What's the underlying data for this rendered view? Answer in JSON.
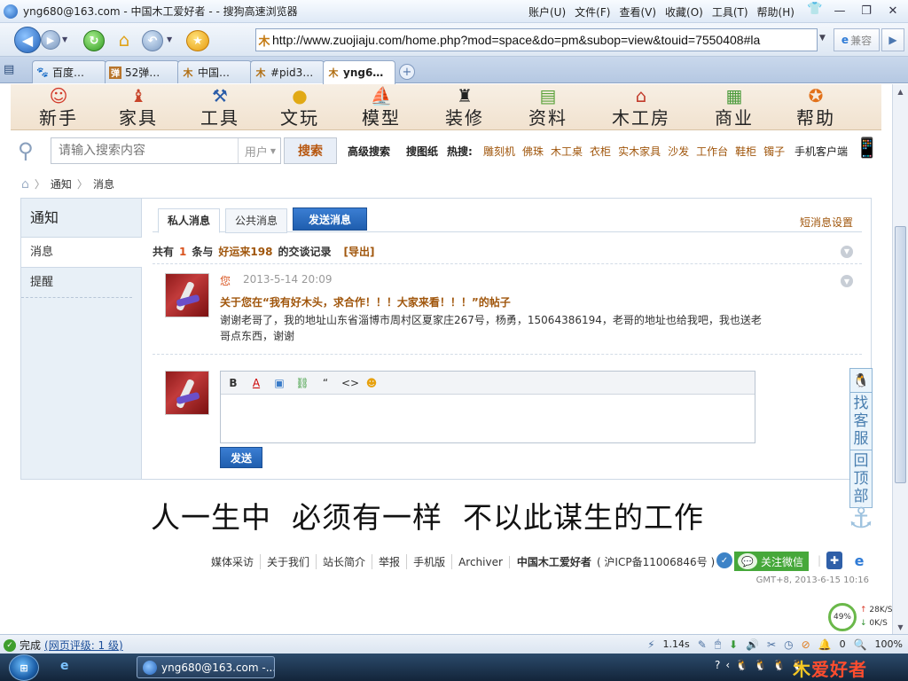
{
  "browser": {
    "window_title": "yng680@163.com - 中国木工爱好者 - - 搜狗高速浏览器",
    "menus": [
      "账户(U)",
      "文件(F)",
      "查看(V)",
      "收藏(O)",
      "工具(T)",
      "帮助(H)"
    ],
    "url": "http://www.zuojiaju.com/home.php?mod=space&do=pm&subop=view&touid=7550408#la",
    "compat_label": "兼容",
    "tabs": [
      {
        "label": "百度…"
      },
      {
        "label": "52弹…"
      },
      {
        "label": "中国…"
      },
      {
        "label": "#pid3…"
      },
      {
        "label": "yng6…"
      }
    ]
  },
  "site_nav": [
    {
      "label": "新手"
    },
    {
      "label": "家具"
    },
    {
      "label": "工具"
    },
    {
      "label": "文玩"
    },
    {
      "label": "模型"
    },
    {
      "label": "装修"
    },
    {
      "label": "资料"
    },
    {
      "label": "木工房"
    },
    {
      "label": "商业"
    },
    {
      "label": "帮助"
    }
  ],
  "search": {
    "placeholder": "请输入搜索内容",
    "type": "用户",
    "button": "搜索",
    "advanced": "高级搜索",
    "drawings": "搜图纸",
    "hot_label": "热搜:",
    "hot": [
      "雕刻机",
      "佛珠",
      "木工桌",
      "衣柜",
      "实木家具",
      "沙发",
      "工作台",
      "鞋柜",
      "镯子"
    ],
    "client": "手机客户端"
  },
  "breadcrumb": {
    "items": [
      "通知",
      "消息"
    ]
  },
  "sidebar": {
    "title": "通知",
    "items": [
      {
        "label": "消息"
      },
      {
        "label": "提醒"
      }
    ]
  },
  "tabs": {
    "private": "私人消息",
    "public": "公共消息",
    "send": "发送消息",
    "settings": "短消息设置"
  },
  "summary": {
    "prefix": "共有",
    "count": "1",
    "middle": "条与",
    "user": "好运来198",
    "suffix": "的交谈记录",
    "export": "[导出]"
  },
  "message": {
    "author": "您",
    "time": "2013-5-14 20:09",
    "subject": "关于您在“我有好木头，求合作！！！大家来看！！！”的帖子",
    "body": "谢谢老哥了，我的地址山东省淄博市周村区夏家庄267号，杨勇，15064386194，老哥的地址也给我吧，我也送老哥点东西，谢谢"
  },
  "reply": {
    "send": "发送"
  },
  "slogan": "人一生中  必须有一样  不以此谋生的工作",
  "side_float": {
    "service": "找客服",
    "top": "回顶部"
  },
  "footer": {
    "links": [
      "媒体采访",
      "关于我们",
      "站长简介",
      "举报",
      "手机版",
      "Archiver"
    ],
    "brand": "中国木工爱好者",
    "icp": "( 沪ICP备11006846号 )",
    "wechat": "关注微信",
    "gmt": "GMT+8, 2013-6-15 10:16"
  },
  "speed": {
    "percent": "49%",
    "up": "28K/S",
    "down": "0K/S"
  },
  "status": {
    "done": "完成",
    "rating": "(网页评级: 1 级)",
    "time": "1.14s",
    "count": "0",
    "zoom": "100%"
  },
  "taskbar": {
    "window": "yng680@163.com -..."
  },
  "colors": {
    "accent": "#a0560c",
    "link_blue": "#1f5eae",
    "nav_bg": "#f1e2cf"
  }
}
